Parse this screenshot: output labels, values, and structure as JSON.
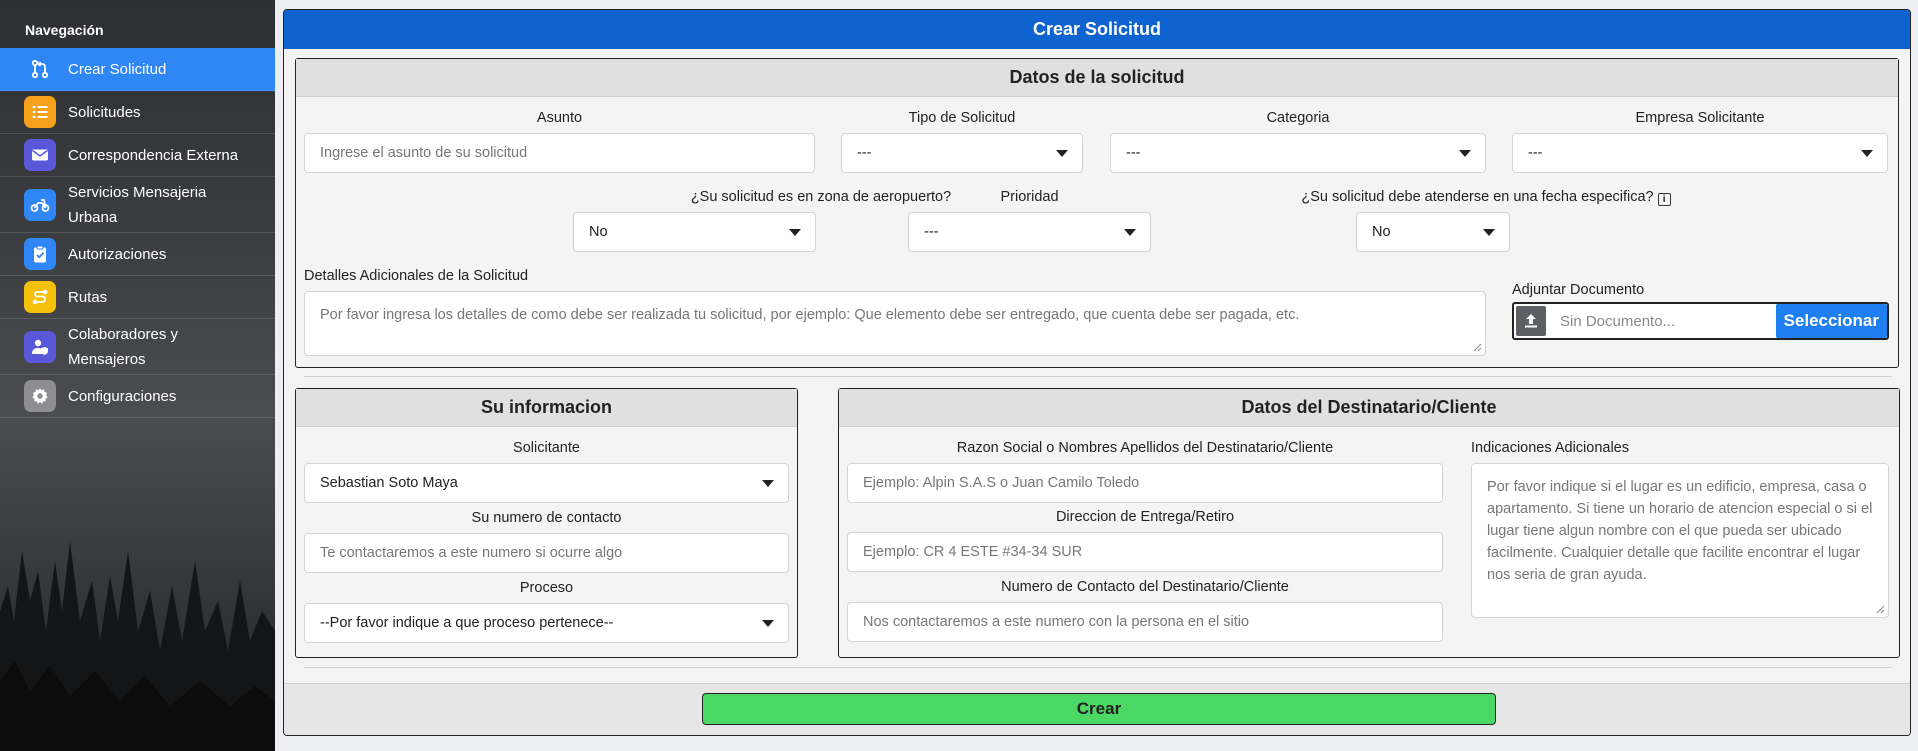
{
  "sidebar": {
    "title": "Navegación",
    "items": [
      {
        "label": "Crear Solicitud",
        "icon": "git-pull-request-icon",
        "color": "#2f86f5"
      },
      {
        "label": "Solicitudes",
        "icon": "list-icon",
        "color": "#f7a11a"
      },
      {
        "label": "Correspondencia Externa",
        "icon": "mail-icon",
        "color": "#5b57d9"
      },
      {
        "label": "Servicios Mensajeria Urbana",
        "icon": "motorcycle-icon",
        "color": "#2f86f5"
      },
      {
        "label": "Autorizaciones",
        "icon": "clipboard-check-icon",
        "color": "#2f86f5"
      },
      {
        "label": "Rutas",
        "icon": "route-icon",
        "color": "#f6c10b"
      },
      {
        "label": "Colaboradores y Mensajeros",
        "icon": "user-shield-icon",
        "color": "#5b57d9"
      },
      {
        "label": "Configuraciones",
        "icon": "gear-icon",
        "color": "#8e8e92"
      }
    ]
  },
  "header": {
    "title": "Crear Solicitud"
  },
  "solicitud": {
    "title": "Datos de la solicitud",
    "asunto": {
      "label": "Asunto",
      "placeholder": "Ingrese el asunto de su solicitud"
    },
    "tipo": {
      "label": "Tipo de Solicitud",
      "value": "---"
    },
    "categoria": {
      "label": "Categoria",
      "value": "---"
    },
    "empresa": {
      "label": "Empresa Solicitante",
      "value": "---"
    },
    "aeropuerto": {
      "label": "¿Su solicitud es en zona de aeropuerto?",
      "value": "No"
    },
    "prioridad": {
      "label": "Prioridad",
      "value": "---"
    },
    "fecha": {
      "label": "¿Su solicitud debe atenderse en una fecha especifica?",
      "value": "No",
      "info": "i"
    },
    "detalles": {
      "label": "Detalles Adicionales de la Solicitud",
      "placeholder": "Por favor ingresa los detalles de como debe ser realizada tu solicitud, por ejemplo: Que elemento debe ser entregado, que cuenta debe ser pagada, etc."
    },
    "adjuntar": {
      "label": "Adjuntar Documento",
      "placeholder": "Sin Documento...",
      "button": "Seleccionar"
    }
  },
  "informacion": {
    "title": "Su informacion",
    "solicitante": {
      "label": "Solicitante",
      "value": "Sebastian Soto Maya"
    },
    "contacto": {
      "label": "Su numero de contacto",
      "placeholder": "Te contactaremos a este numero si ocurre algo"
    },
    "proceso": {
      "label": "Proceso",
      "value": "--Por favor indique a que proceso pertenece--"
    }
  },
  "destinatario": {
    "title": "Datos del Destinatario/Cliente",
    "razon": {
      "label": "Razon Social o Nombres Apellidos del Destinatario/Cliente",
      "placeholder": "Ejemplo: Alpin S.A.S o Juan Camilo Toledo"
    },
    "direccion": {
      "label": "Direccion de Entrega/Retiro",
      "placeholder": "Ejemplo: CR 4 ESTE #34-34 SUR"
    },
    "contacto": {
      "label": "Numero de Contacto del Destinatario/Cliente",
      "placeholder": "Nos contactaremos a este numero con la persona en el sitio"
    },
    "indicaciones": {
      "label": "Indicaciones Adicionales",
      "placeholder": "Por favor indique si el lugar es un edificio, empresa, casa o apartamento. Si tiene un horario de atencion especial o si el lugar tiene algun nombre con el que pueda ser ubicado facilmente. Cualquier detalle que facilite encontrar el lugar nos seria de gran ayuda."
    }
  },
  "actions": {
    "create": "Crear"
  }
}
